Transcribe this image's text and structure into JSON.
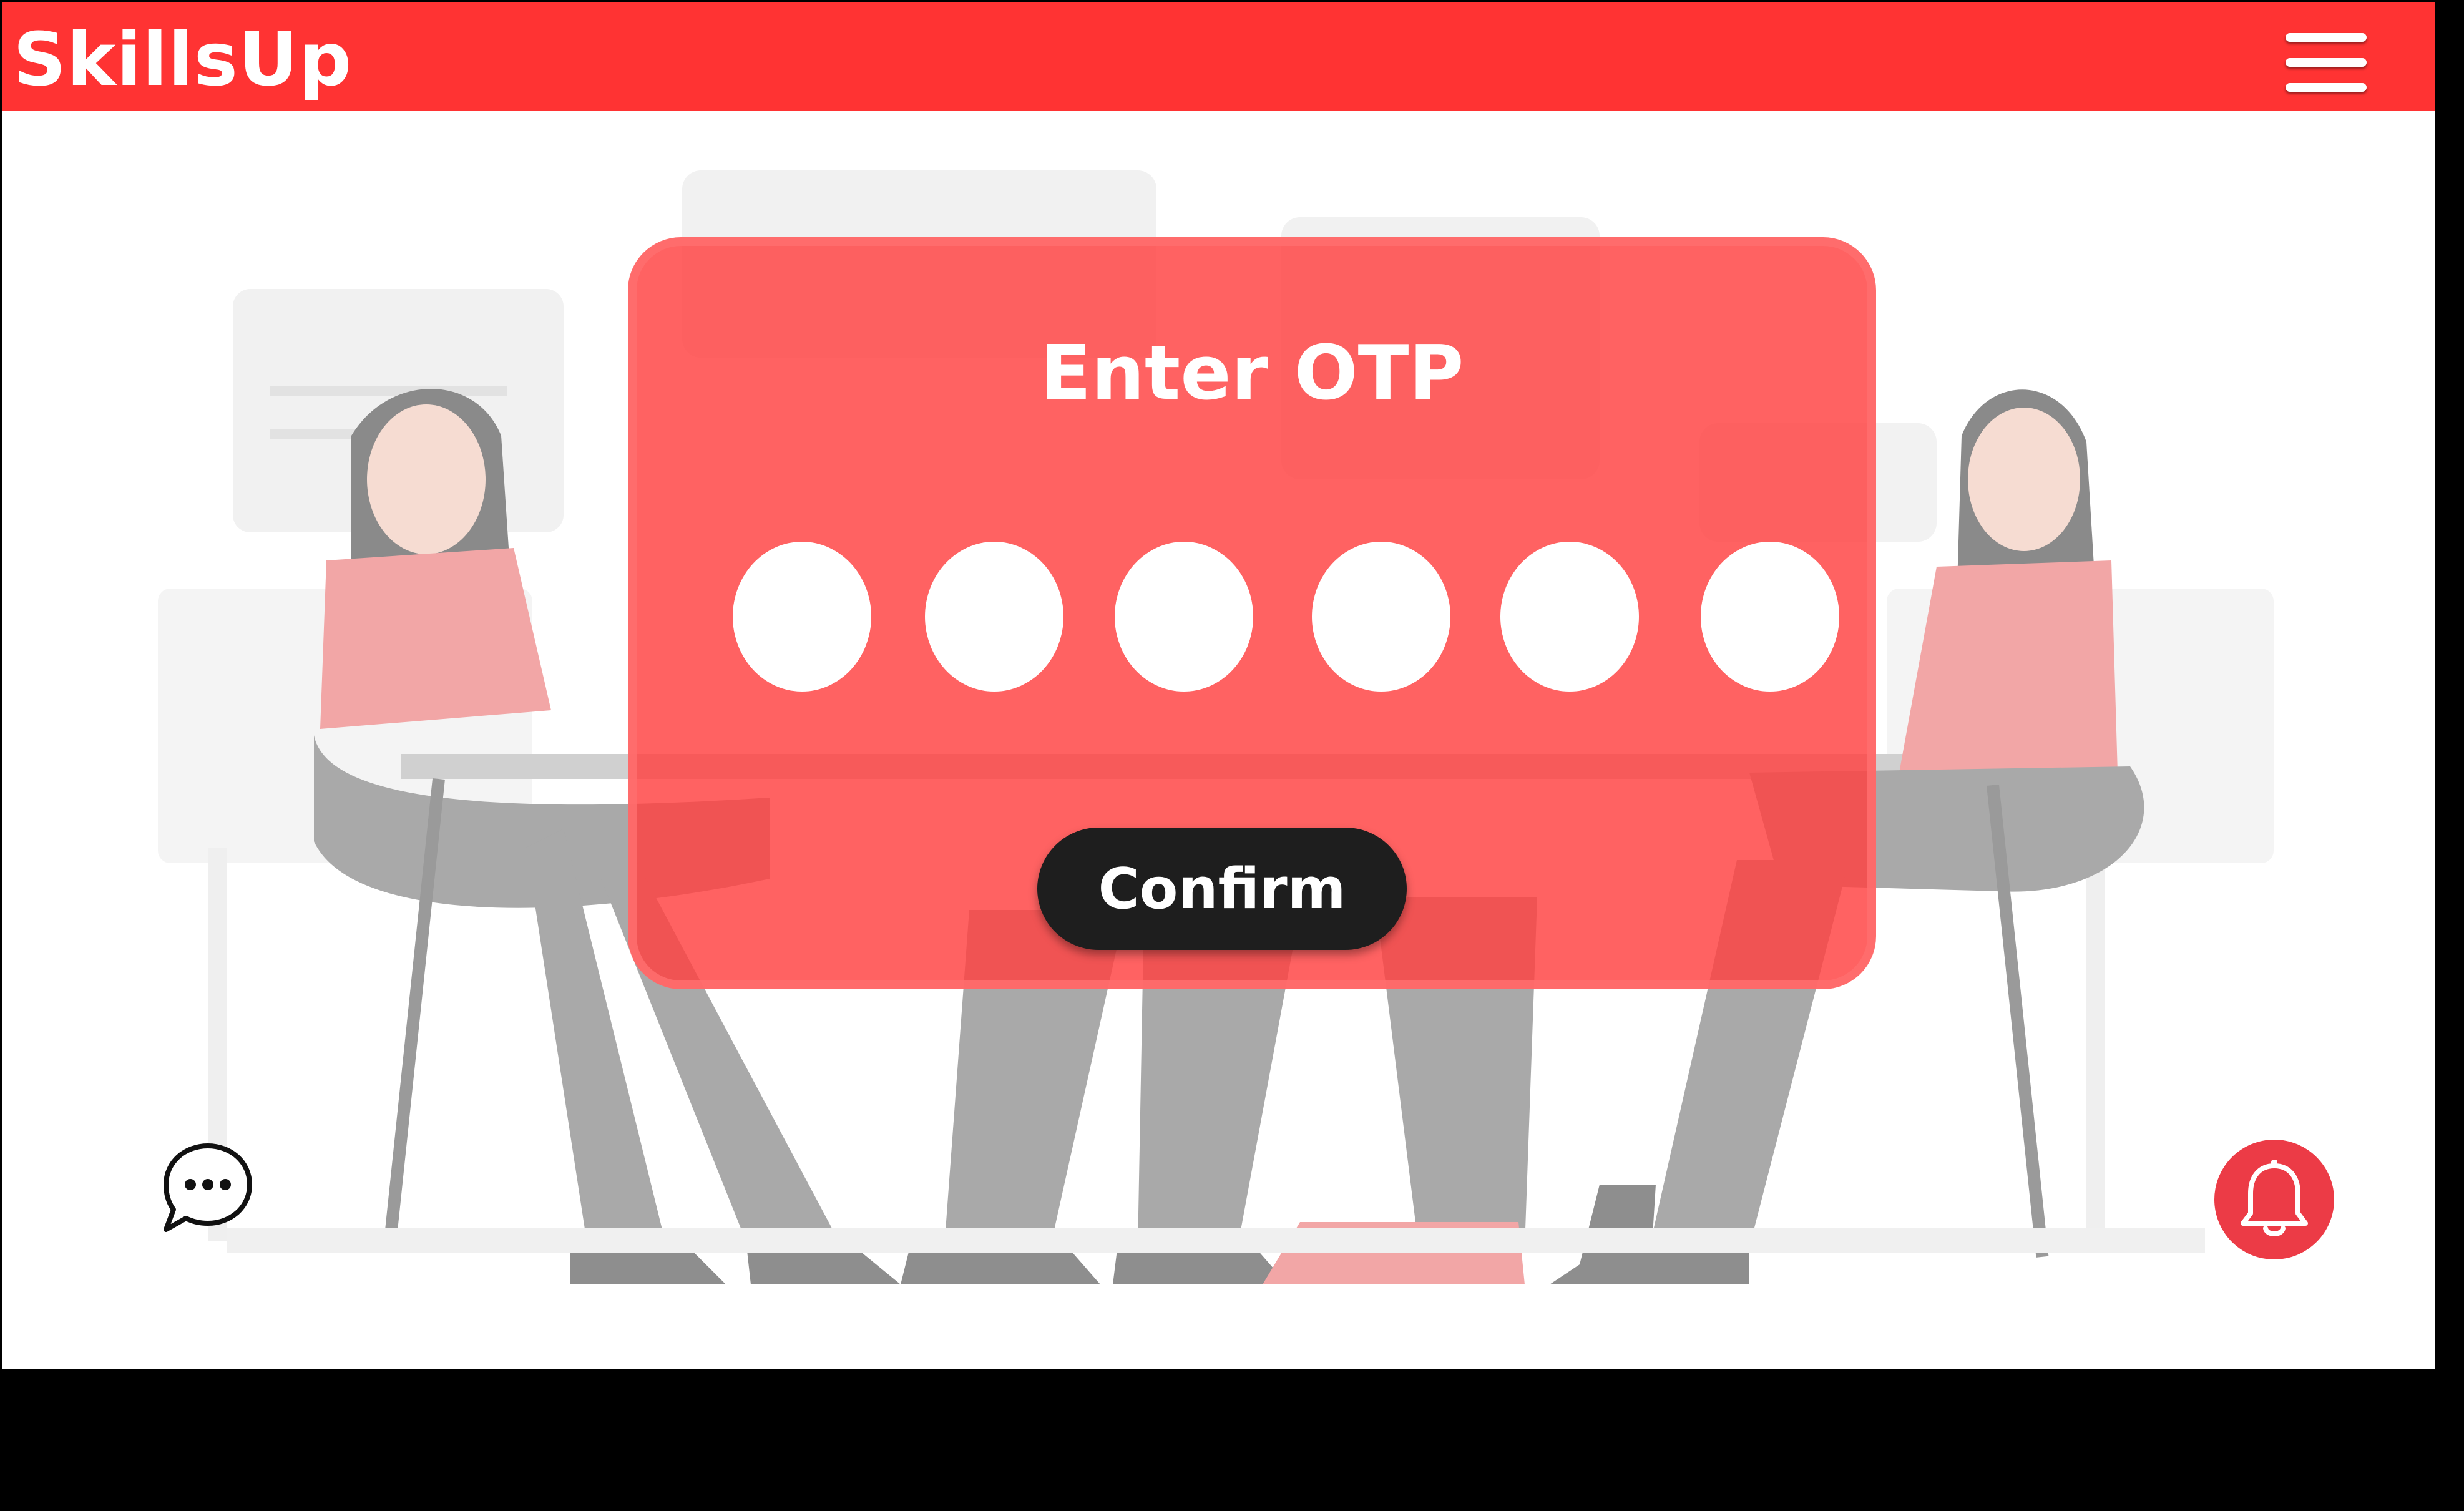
{
  "app": {
    "brand": "SkillsUp"
  },
  "header": {
    "menu_icon": "hamburger-menu-icon"
  },
  "otp_dialog": {
    "title": "Enter OTP",
    "digits": [
      "",
      "",
      "",
      "",
      "",
      ""
    ],
    "confirm_label": "Confirm"
  },
  "floating": {
    "chat_icon": "chat-bubble-icon",
    "bell_icon": "bell-icon"
  },
  "colors": {
    "brand_red": "#ff3333",
    "dialog_red": "#ff4040",
    "button_dark": "#1e1e1e",
    "bell_red": "#ec3b46"
  }
}
